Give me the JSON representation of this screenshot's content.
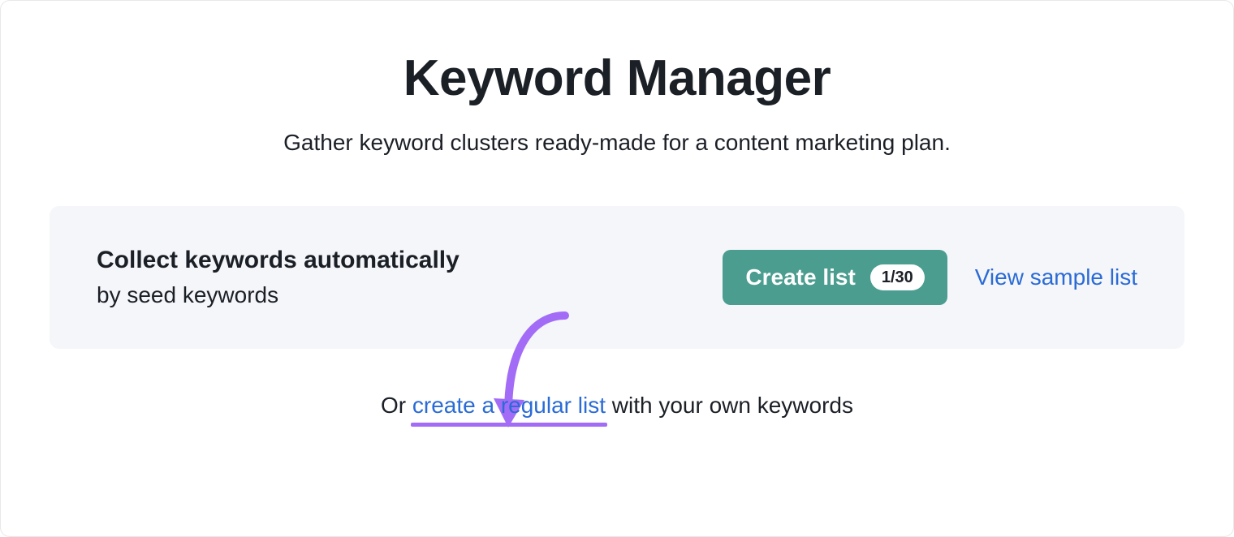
{
  "header": {
    "title": "Keyword Manager",
    "subtitle": "Gather keyword clusters ready-made for a content marketing plan."
  },
  "card": {
    "heading": "Collect keywords automatically",
    "subheading": "by seed keywords",
    "create_button_label": "Create list",
    "create_button_badge": "1/30",
    "sample_link": "View sample list"
  },
  "footer": {
    "prefix": "Or ",
    "link": "create a regular list",
    "suffix": " with your own keywords"
  },
  "colors": {
    "accent_green": "#4a9d8f",
    "link_blue": "#2a6bd6",
    "annotation_purple": "#a36cf6"
  }
}
